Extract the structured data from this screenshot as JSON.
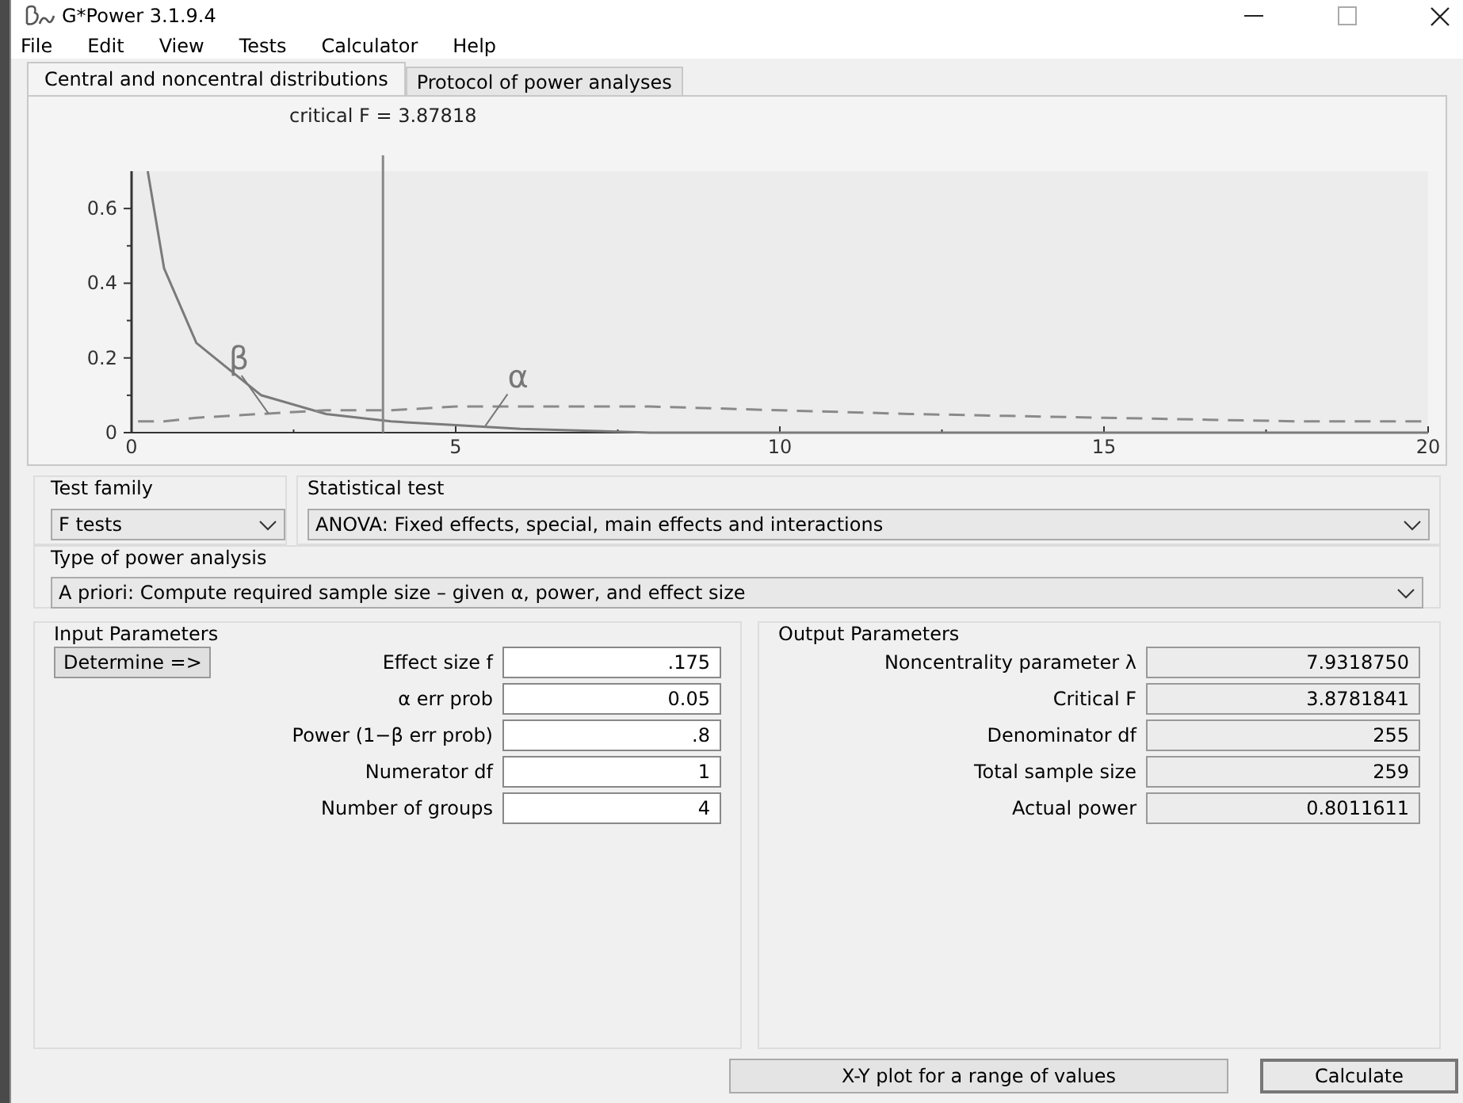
{
  "window": {
    "title": "G*Power 3.1.9.4"
  },
  "menu": [
    "File",
    "Edit",
    "View",
    "Tests",
    "Calculator",
    "Help"
  ],
  "tabs": [
    {
      "label": "Central and noncentral distributions",
      "selected": true
    },
    {
      "label": "Protocol of power analyses",
      "selected": false
    }
  ],
  "distribution_plot": {
    "chart_data": {
      "type": "line",
      "x": [
        0.1,
        0.25,
        0.5,
        1,
        2,
        3,
        4,
        5,
        6,
        8,
        10,
        12,
        15,
        18,
        20
      ],
      "xlim": [
        0,
        20
      ],
      "ylim": [
        0,
        0.7
      ],
      "xticks": [
        0,
        5,
        10,
        15,
        20
      ],
      "yticks": [
        0,
        0.2,
        0.4,
        0.6
      ],
      "series": [
        {
          "color": "#7a7a7a",
          "line_style": "solid",
          "values": [
            null,
            0.7,
            0.44,
            0.24,
            0.1,
            0.05,
            0.03,
            0.02,
            0.01,
            0,
            0,
            0,
            0,
            0,
            0
          ]
        },
        {
          "color": "#8a8a8a",
          "line_style": "dashed",
          "values": [
            0.03,
            0.03,
            0.03,
            0.04,
            0.05,
            0.06,
            0.06,
            0.07,
            0.07,
            0.07,
            0.06,
            0.05,
            0.04,
            0.03,
            0.03
          ]
        }
      ],
      "ref_lines": [
        {
          "axis": "x",
          "value": 3.87818,
          "label": "critical F = 3.87818"
        }
      ]
    },
    "curve_labels": [
      "β",
      "α"
    ]
  },
  "test_family": {
    "label": "Test family",
    "value": "F tests"
  },
  "statistical_test": {
    "label": "Statistical test",
    "value": "ANOVA: Fixed effects, special, main effects and interactions"
  },
  "power_analysis_type": {
    "label": "Type of power analysis",
    "value": "A priori: Compute required sample size – given α, power, and effect size"
  },
  "input_parameters": {
    "title": "Input Parameters",
    "determine_button": "Determine =>",
    "fields": [
      {
        "label": "Effect size f",
        "value": ".175"
      },
      {
        "label": "α err prob",
        "value": "0.05"
      },
      {
        "label": "Power (1−β err prob)",
        "value": ".8"
      },
      {
        "label": "Numerator df",
        "value": "1"
      },
      {
        "label": "Number of groups",
        "value": "4"
      }
    ]
  },
  "output_parameters": {
    "title": "Output Parameters",
    "fields": [
      {
        "label": "Noncentrality parameter λ",
        "value": "7.9318750"
      },
      {
        "label": "Critical F",
        "value": "3.8781841"
      },
      {
        "label": "Denominator df",
        "value": "255"
      },
      {
        "label": "Total sample size",
        "value": "259"
      },
      {
        "label": "Actual power",
        "value": "0.8011611"
      }
    ]
  },
  "buttons": [
    "X-Y plot for a range of values",
    "Calculate"
  ]
}
